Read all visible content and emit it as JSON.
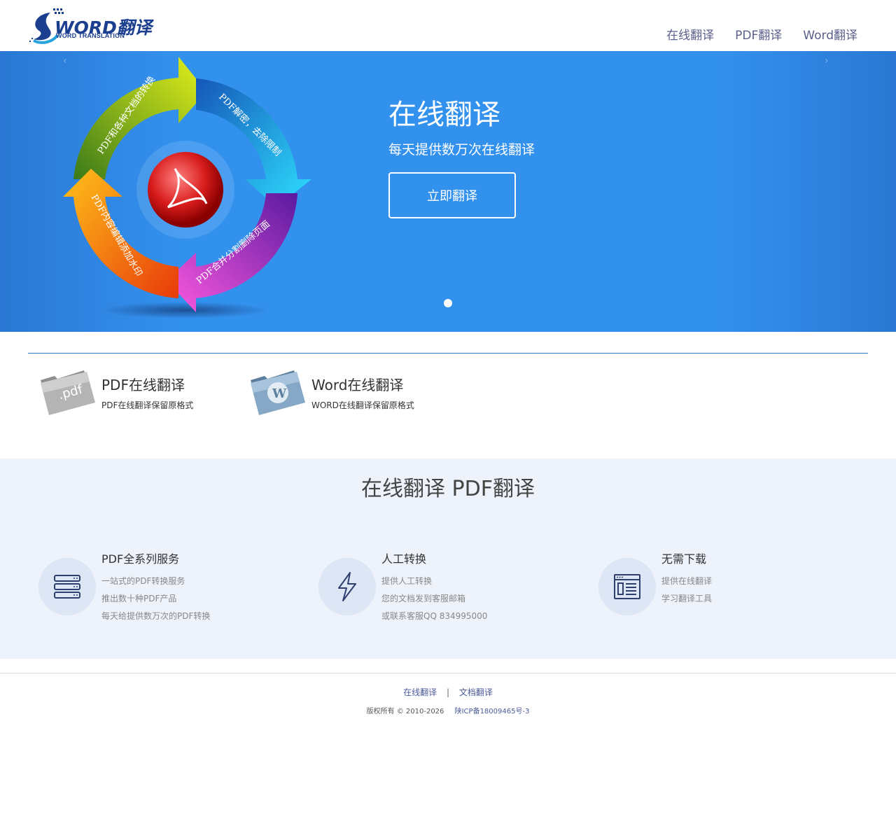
{
  "header": {
    "logo": {
      "word": "WORD翻译",
      "sub": "WORD TRANSLATION"
    },
    "nav": [
      {
        "label": "在线翻译"
      },
      {
        "label": "PDF翻译"
      },
      {
        "label": "Word翻译"
      }
    ]
  },
  "banner": {
    "cycle_labels": [
      "PDF和各种文档的转换",
      "PDF解密，去除限制",
      "PDF合并分割删除页面",
      "PDF内容编辑添加水印"
    ],
    "title": "在线翻译",
    "subtitle": "每天提供数万次在线翻译",
    "button": "立即翻译",
    "slides": 1
  },
  "services": [
    {
      "title": "PDF在线翻译",
      "desc": "PDF在线翻译保留原格式",
      "icon": "pdf-folder-icon"
    },
    {
      "title": "Word在线翻译",
      "desc": "WORD在线翻译保留原格式",
      "icon": "wordpress-folder-icon"
    }
  ],
  "features": {
    "title": "在线翻译 PDF翻译",
    "items": [
      {
        "title": "PDF全系列服务",
        "lines": [
          "一站式的PDF转换服务",
          "推出数十种PDF产品",
          "每天给提供数万次的PDF转换"
        ],
        "icon": "server-icon"
      },
      {
        "title": "人工转换",
        "lines": [
          "提供人工转换",
          "您的文档发到客服邮箱",
          "或联系客服QQ 834995000"
        ],
        "icon": "lightning-icon"
      },
      {
        "title": "无需下载",
        "lines": [
          "提供在线翻译",
          "学习翻译工具"
        ],
        "icon": "browser-window-icon"
      }
    ]
  },
  "footer": {
    "links": [
      "在线翻译",
      "文档翻译"
    ],
    "separator": "|",
    "copyright": "版权所有 © 2010-2026",
    "icp": "陕ICP备18009465号-3"
  },
  "colors": {
    "banner": "#3391ee",
    "nav": "#5a5f8a",
    "features_bg": "#edf2fb",
    "divider": "#2f7cc7"
  }
}
